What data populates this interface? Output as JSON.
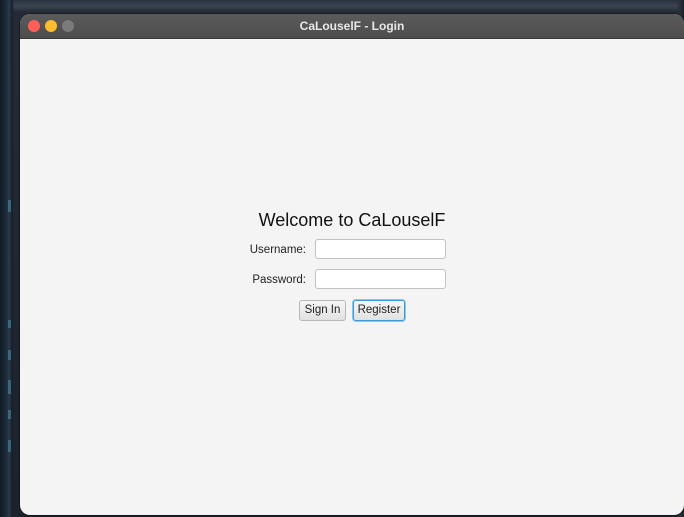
{
  "window": {
    "title": "CaLouselF - Login"
  },
  "login": {
    "heading": "Welcome to CaLouselF",
    "username_label": "Username:",
    "username_value": "",
    "password_label": "Password:",
    "password_value": "",
    "sign_in_label": "Sign In",
    "register_label": "Register"
  },
  "colors": {
    "close": "#ff5f57",
    "minimize": "#febc2e",
    "maximize_disabled": "#7b7b7b",
    "focus_ring": "#3b9ad9"
  }
}
